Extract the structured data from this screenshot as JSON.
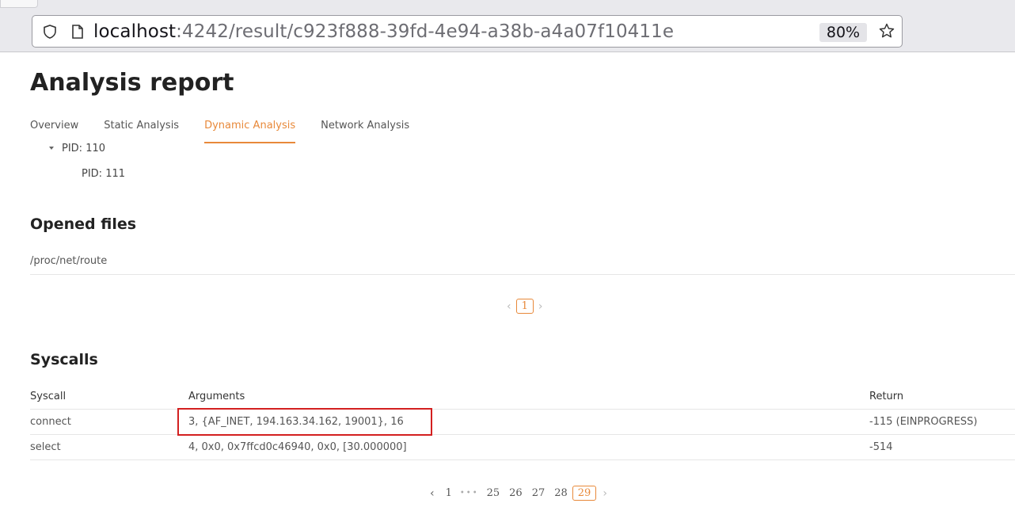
{
  "browser": {
    "url_host": "localhost",
    "url_rest": ":4242/result/c923f888-39fd-4e94-a38b-a4a07f10411e",
    "zoom": "80%"
  },
  "page": {
    "title": "Analysis report",
    "tabs": [
      {
        "label": "Overview",
        "active": false
      },
      {
        "label": "Static Analysis",
        "active": false
      },
      {
        "label": "Dynamic Analysis",
        "active": true
      },
      {
        "label": "Network Analysis",
        "active": false
      }
    ],
    "process_tree": [
      {
        "label": "PID: 110",
        "expanded": true
      },
      {
        "label": "PID: 111"
      }
    ]
  },
  "opened_files": {
    "title": "Opened files",
    "items": [
      "/proc/net/route"
    ],
    "pagination": {
      "current": "1"
    }
  },
  "syscalls": {
    "title": "Syscalls",
    "headers": {
      "syscall": "Syscall",
      "arguments": "Arguments",
      "return": "Return"
    },
    "rows": [
      {
        "syscall": "connect",
        "arguments": "3, {AF_INET, 194.163.34.162, 19001}, 16",
        "return": "-115 (EINPROGRESS)"
      },
      {
        "syscall": "select",
        "arguments": "4, 0x0, 0x7ffcd0c46940, 0x0, [30.000000]",
        "return": "-514"
      }
    ],
    "pagination": {
      "first": "1",
      "pages": [
        "25",
        "26",
        "27",
        "28"
      ],
      "current": "29"
    }
  }
}
